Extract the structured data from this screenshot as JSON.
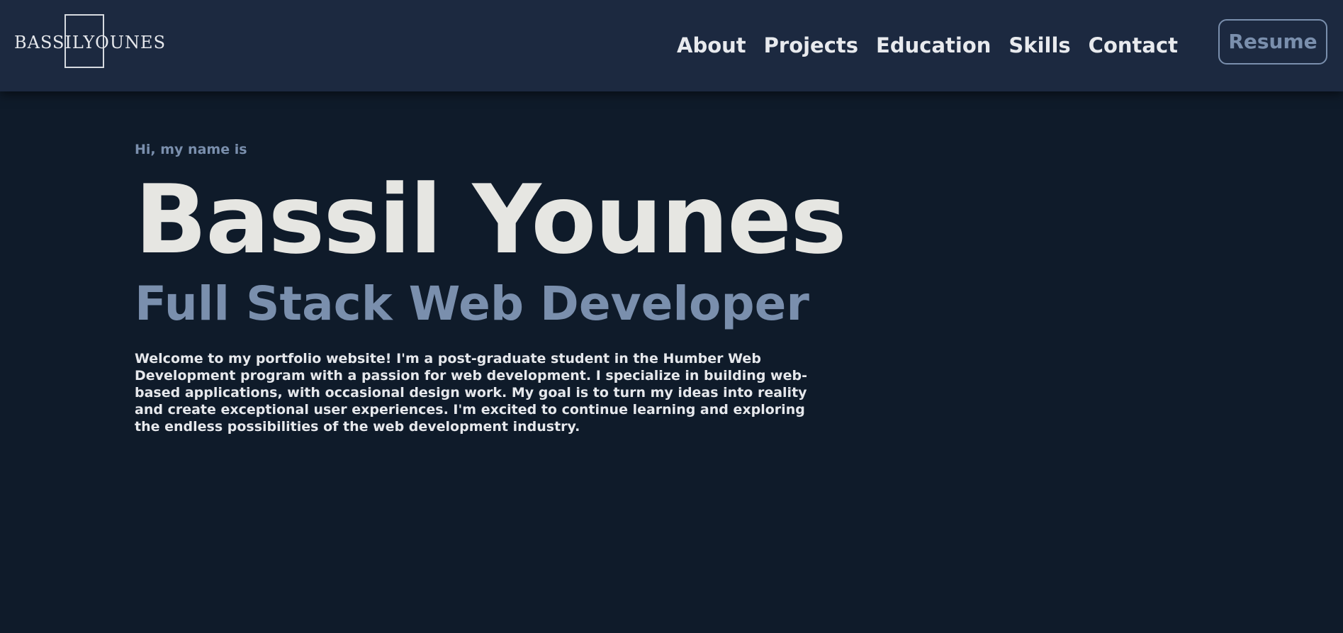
{
  "header": {
    "logo_text": "BASSILYOUNES",
    "nav": [
      {
        "label": "About"
      },
      {
        "label": "Projects"
      },
      {
        "label": "Education"
      },
      {
        "label": "Skills"
      },
      {
        "label": "Contact"
      }
    ],
    "resume_label": "Resume"
  },
  "hero": {
    "greeting": "Hi, my name is",
    "name": "Bassil Younes",
    "title": "Full Stack Web Developer",
    "intro": "Welcome to my portfolio website! I'm a post-graduate student in the Humber Web Development program with a passion for web development. I specialize in building web-based applications, with occasional design work. My goal is to turn my ideas into reality and create exceptional user experiences. I'm excited to continue learning and exploring the endless possibilities of the web development industry."
  },
  "colors": {
    "background": "#0f1b2a",
    "header_background": "#1c2940",
    "accent": "#7a8fad",
    "text_light": "#e6e6e2"
  }
}
